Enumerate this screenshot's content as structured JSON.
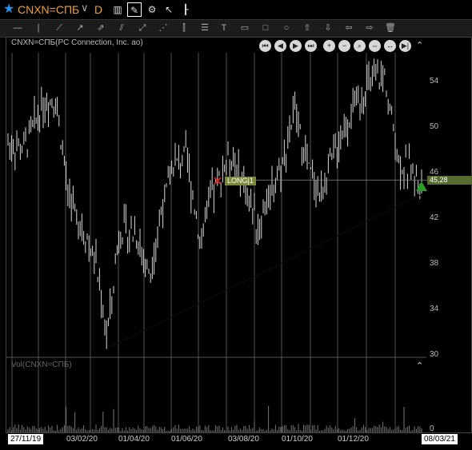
{
  "header": {
    "symbol": "CNXN=СПБ",
    "period": "D"
  },
  "chart_label": "CNXN=СПБ(PC Connection, Inc. ao)",
  "volume_label": "Vol(CNXN=СПБ)",
  "y_ticks": [
    "54",
    "50",
    "46",
    "42",
    "38",
    "34",
    "30"
  ],
  "volume_ticks": [
    "0"
  ],
  "x_start_label": "27/11/19",
  "x_end_label": "08/03/21",
  "x_ticks": [
    "03/02/20",
    "01/04/20",
    "01/06/20",
    "03/08/20",
    "01/10/20",
    "01/12/20"
  ],
  "long_label": "LONG|1",
  "last_price": "45,28",
  "colors": {
    "accent": "#f0a030",
    "star": "#2d8ee8",
    "bars": "#d8d8d8",
    "long_tag": "#7a8a3a",
    "triangle": "#2aa02a",
    "marker": "#e02020"
  },
  "chart_data": {
    "type": "ohlc",
    "title": "CNXN=СПБ(PC Connection, Inc. ao)",
    "ylim": [
      29,
      57
    ],
    "x_range": [
      "27/11/19",
      "08/03/21"
    ],
    "close_approx": [
      [
        "27/11/19",
        48.5
      ],
      [
        "15/12/19",
        48.0
      ],
      [
        "05/01/20",
        52.0
      ],
      [
        "20/01/20",
        52.5
      ],
      [
        "03/02/20",
        44.0
      ],
      [
        "20/02/20",
        41.0
      ],
      [
        "05/03/20",
        38.0
      ],
      [
        "18/03/20",
        31.5
      ],
      [
        "01/04/20",
        41.0
      ],
      [
        "20/04/20",
        40.5
      ],
      [
        "05/05/20",
        37.0
      ],
      [
        "18/05/20",
        42.5
      ],
      [
        "01/06/20",
        46.5
      ],
      [
        "15/06/20",
        47.5
      ],
      [
        "01/07/20",
        40.0
      ],
      [
        "15/07/20",
        44.0
      ],
      [
        "03/08/20",
        47.5
      ],
      [
        "20/08/20",
        45.0
      ],
      [
        "05/09/20",
        41.0
      ],
      [
        "20/09/20",
        45.0
      ],
      [
        "01/10/20",
        46.5
      ],
      [
        "15/10/20",
        51.5
      ],
      [
        "01/11/20",
        46.0
      ],
      [
        "15/11/20",
        44.0
      ],
      [
        "01/12/20",
        48.0
      ],
      [
        "20/12/20",
        51.5
      ],
      [
        "05/01/21",
        53.5
      ],
      [
        "25/01/21",
        54.5
      ],
      [
        "10/02/21",
        47.0
      ],
      [
        "08/03/21",
        45.28
      ]
    ],
    "trendline": {
      "from": [
        "18/03/20",
        30.5
      ],
      "to": [
        "08/03/21",
        44.0
      ]
    },
    "long_entry": 45.28
  }
}
